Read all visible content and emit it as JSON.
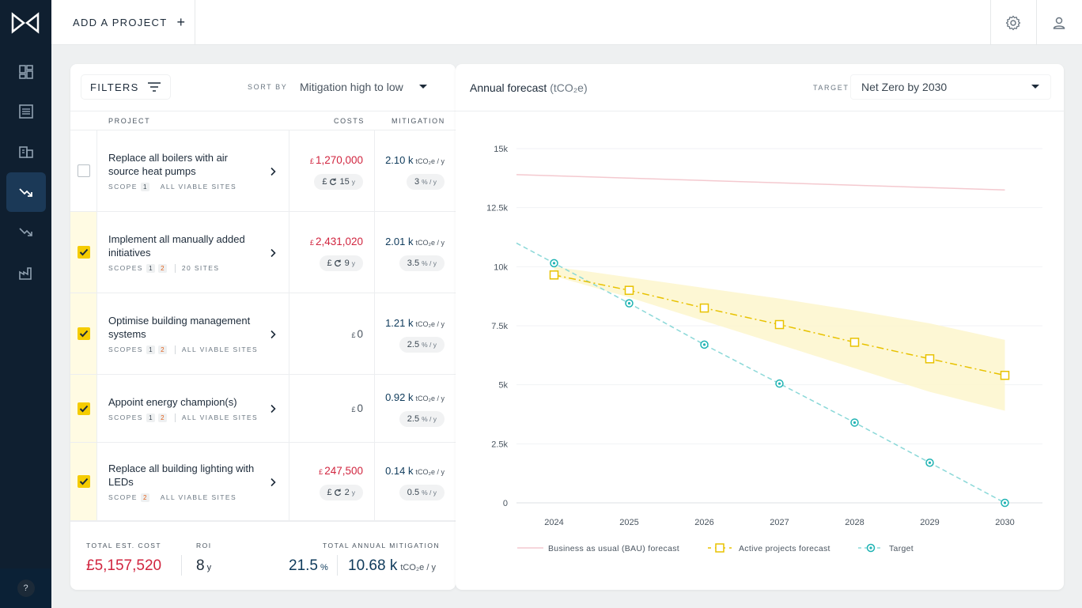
{
  "topbar": {
    "add_project_label": "ADD A PROJECT",
    "plus_glyph": "+",
    "settings_icon": "gear-icon",
    "user_icon": "user-icon"
  },
  "sidebar": {
    "items": [
      {
        "icon": "dashboard-icon",
        "active": false
      },
      {
        "icon": "list-icon",
        "active": false
      },
      {
        "icon": "building-icon",
        "active": false
      },
      {
        "icon": "trend-down-icon",
        "active": true
      },
      {
        "icon": "trend-down-small-icon",
        "active": false
      },
      {
        "icon": "factory-icon",
        "active": false
      }
    ],
    "help_label": "?"
  },
  "projects_panel": {
    "filters_label": "FILTERS",
    "sort_label": "SORT BY",
    "sort_value": "Mitigation high to low",
    "columns": {
      "project": "PROJECT",
      "costs": "COSTS",
      "mitigation": "MITIGATION"
    },
    "rows": [
      {
        "checked": false,
        "title": "Replace all boilers with air source heat pumps",
        "scope_label": "SCOPE",
        "scopes": [
          "1"
        ],
        "sites": "ALL VIABLE SITES",
        "cost_currency": "£",
        "cost_value": "1,270,000",
        "payback_prefix": "£",
        "payback_icon": "payback-icon",
        "payback_value": "15",
        "payback_unit": "y",
        "mitigation_value": "2.10 k",
        "mitigation_unit": "tCO₂e / y",
        "mitigation_pct": "3",
        "mitigation_pct_unit": "% / y"
      },
      {
        "checked": true,
        "title": "Implement all manually added initiatives",
        "scope_label": "SCOPES",
        "scopes": [
          "1",
          "2"
        ],
        "sites": "20 SITES",
        "cost_currency": "£",
        "cost_value": "2,431,020",
        "payback_prefix": "£",
        "payback_icon": "payback-icon",
        "payback_value": "9",
        "payback_unit": "y",
        "mitigation_value": "2.01 k",
        "mitigation_unit": "tCO₂e / y",
        "mitigation_pct": "3.5",
        "mitigation_pct_unit": "% / y"
      },
      {
        "checked": true,
        "title": "Optimise building management systems",
        "scope_label": "SCOPES",
        "scopes": [
          "1",
          "2"
        ],
        "sites": "ALL VIABLE SITES",
        "cost_currency": "£",
        "cost_value": "0",
        "mitigation_value": "1.21 k",
        "mitigation_unit": "tCO₂e / y",
        "mitigation_pct": "2.5",
        "mitigation_pct_unit": "% / y"
      },
      {
        "checked": true,
        "title": "Appoint energy champion(s)",
        "scope_label": "SCOPES",
        "scopes": [
          "1",
          "2"
        ],
        "sites": "ALL VIABLE SITES",
        "cost_currency": "£",
        "cost_value": "0",
        "mitigation_value": "0.92 k",
        "mitigation_unit": "tCO₂e / y",
        "mitigation_pct": "2.5",
        "mitigation_pct_unit": "% / y"
      },
      {
        "checked": true,
        "title": "Replace all building lighting with LEDs",
        "scope_label": "SCOPE",
        "scopes": [
          "2"
        ],
        "sites": "ALL VIABLE SITES",
        "cost_currency": "£",
        "cost_value": "247,500",
        "payback_prefix": "£",
        "payback_icon": "payback-icon",
        "payback_value": "2",
        "payback_unit": "y",
        "mitigation_value": "0.14 k",
        "mitigation_unit": "tCO₂e / y",
        "mitigation_pct": "0.5",
        "mitigation_pct_unit": "% / y"
      }
    ],
    "totals": {
      "cost_label": "TOTAL EST. COST",
      "cost_value": "£5,157,520",
      "roi_label": "ROI",
      "roi_value": "8",
      "roi_unit": "y",
      "mitigation_label": "TOTAL ANNUAL MITIGATION",
      "mitigation_pct": "21.5",
      "mitigation_pct_unit": "%",
      "mitigation_value": "10.68 k",
      "mitigation_unit": "tCO₂e / y"
    }
  },
  "forecast_panel": {
    "title": "Annual forecast",
    "title_unit": "(tCO₂e)",
    "target_label": "TARGET",
    "target_value": "Net Zero by 2030"
  },
  "colors": {
    "bau": "#f4c9cf",
    "active": "#e8c200",
    "active_band": "#fdf6cc",
    "target": "#1fb3b3",
    "cost_red": "#d1253f",
    "sidebar_bg": "#0f1f30"
  },
  "chart_data": {
    "type": "line",
    "x": [
      2024,
      2025,
      2026,
      2027,
      2028,
      2029,
      2030
    ],
    "ylim": [
      0,
      15000
    ],
    "y_ticks": [
      "0",
      "2.5k",
      "5k",
      "7.5k",
      "10k",
      "12.5k",
      "15k"
    ],
    "y_tick_values": [
      0,
      2500,
      5000,
      7500,
      10000,
      12500,
      15000
    ],
    "grid": true,
    "legend_position": "bottom",
    "series": [
      {
        "name": "Business as usual (BAU) forecast",
        "style": "solid",
        "x": [
          2023.5,
          2030
        ],
        "values": [
          13900,
          13250
        ]
      },
      {
        "name": "Active projects forecast",
        "style": "dashdot-square",
        "values": [
          9650,
          9000,
          8250,
          7550,
          6800,
          6100,
          5400
        ],
        "band_low": [
          9600,
          8700,
          7700,
          6700,
          5700,
          4700,
          3900
        ],
        "band_high": [
          10000,
          9550,
          9100,
          8650,
          8150,
          7600,
          6900
        ]
      },
      {
        "name": "Target",
        "style": "dashed-circle",
        "x": [
          2023.5,
          2024,
          2025,
          2026,
          2027,
          2028,
          2029,
          2030
        ],
        "values": [
          11000,
          10150,
          8450,
          6700,
          5050,
          3400,
          1700,
          0
        ]
      }
    ]
  }
}
